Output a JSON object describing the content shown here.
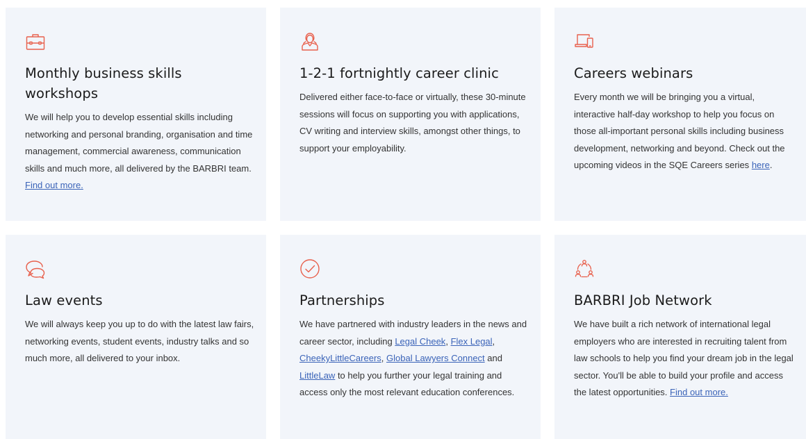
{
  "accent_color": "#e8604c",
  "card_background": "#f2f5fa",
  "link_color": "#3a63b8",
  "cards": [
    {
      "icon": "briefcase-icon",
      "title": "Monthly business skills workshops",
      "text": "We will help you to develop essential skills including networking and personal branding, organisation and time management, commercial awareness, communication skills and much more, all delivered by the BARBRI team.",
      "link": "Find out more."
    },
    {
      "icon": "person-icon",
      "title": "1-2-1 fortnightly career clinic",
      "text": "Delivered either face-to-face or virtually, these 30-minute sessions will focus on supporting you with applications, CV writing and interview skills, amongst other things, to support your employability."
    },
    {
      "icon": "devices-icon",
      "title": "Careers webinars",
      "text": "Every month we will be bringing you a virtual, interactive half-day workshop to help you focus on those all-important personal skills including business development, networking and beyond. Check out the upcoming videos in the SQE Careers series",
      "link": "here",
      "text_after": "."
    },
    {
      "icon": "chat-bubbles-icon",
      "title": "Law events",
      "text": "We will always keep you up to do with the latest law fairs, networking events, student events, industry talks and so much more, all delivered to your inbox."
    },
    {
      "icon": "check-circle-icon",
      "title": "Partnerships",
      "text_1": "We have partnered with industry leaders in the news and career sector, including",
      "link_legal_cheek": "Legal Cheek",
      "sep_1": ",",
      "link_flex_legal": "Flex Legal",
      "sep_2": ",",
      "link_cheeky": "CheekyLittleCareers",
      "sep_3": ",",
      "link_glc": "Global Lawyers Connect",
      "sep_4": "and",
      "link_littlelaw": "LittleLaw",
      "text_2": "to help you further your legal training and access only the most relevant education conferences."
    },
    {
      "icon": "network-icon",
      "title": "BARBRI Job Network",
      "text": "We have built a rich network of international legal employers who are interested in recruiting talent from law schools to help you find your dream job in the legal sector. You'll be able to build your profile and access the latest opportunities.",
      "link": "Find out more."
    }
  ]
}
